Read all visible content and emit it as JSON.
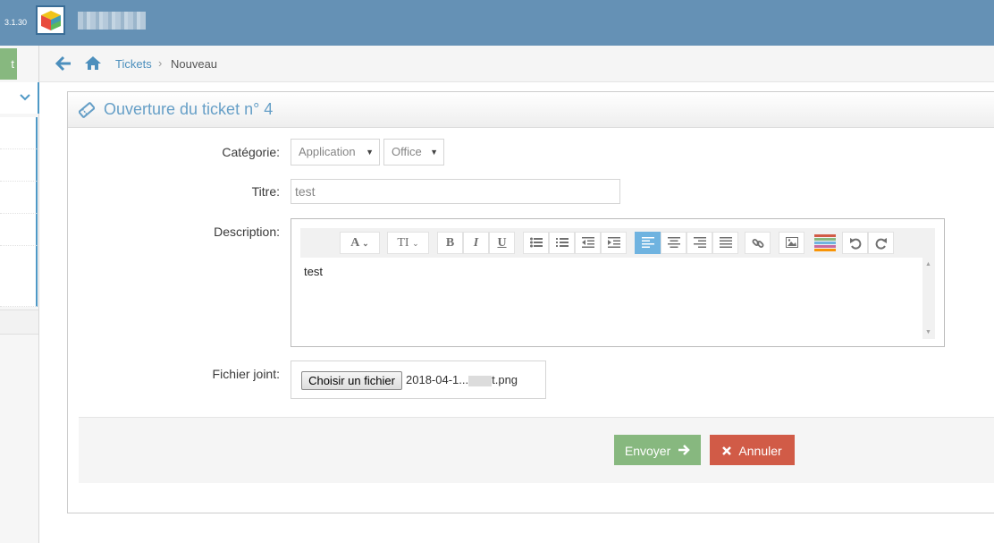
{
  "app": {
    "version": "3.1.30"
  },
  "sidebar": {
    "shortcut_label": "t"
  },
  "breadcrumb": {
    "parent": "Tickets",
    "separator": "›",
    "current": "Nouveau"
  },
  "form": {
    "title": "Ouverture du ticket n° 4",
    "category": {
      "label": "Catégorie:",
      "value": "Application",
      "subvalue": "Office"
    },
    "title_field": {
      "label": "Titre:",
      "value": "test"
    },
    "description": {
      "label": "Description:",
      "content": "test",
      "toolbar": {
        "font": "A",
        "font_size": "TI",
        "bold": "B",
        "italic": "I",
        "underline": "U"
      }
    },
    "attachment": {
      "label": "Fichier joint:",
      "button": "Choisir un fichier",
      "filename_start": "2018-04-1...",
      "filename_end": "t.png"
    }
  },
  "actions": {
    "submit": "Envoyer",
    "cancel": "Annuler"
  },
  "colors": {
    "topbar": "#6591b5",
    "accent": "#669fc7",
    "success": "#87b87f",
    "danger": "#d15b47",
    "active_tool": "#6fb3e0"
  }
}
